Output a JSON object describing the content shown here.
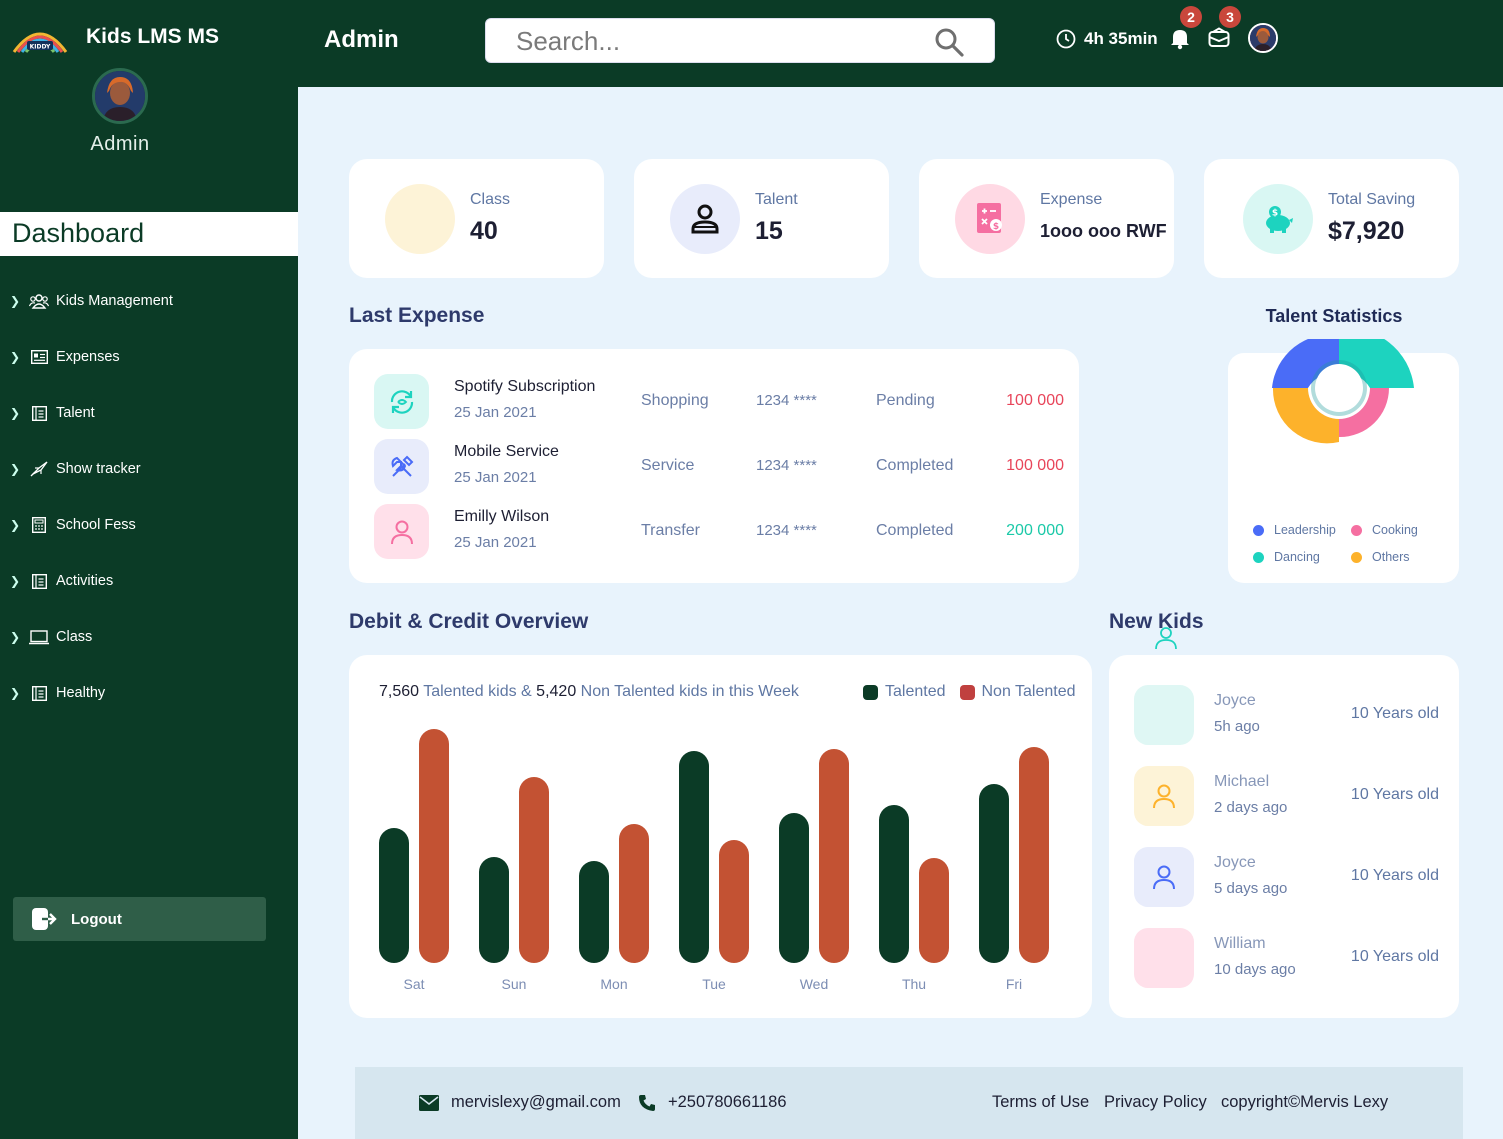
{
  "app": {
    "title": "Kids LMS MS",
    "logo_text": "KIDDY"
  },
  "sidebar": {
    "user_role": "Admin",
    "active": "Dashboard",
    "items": [
      {
        "label": "Kids Management",
        "icon": "users-icon"
      },
      {
        "label": "Expenses",
        "icon": "id-card-icon"
      },
      {
        "label": "Talent",
        "icon": "document-icon"
      },
      {
        "label": "Show tracker",
        "icon": "rocket-icon"
      },
      {
        "label": "School Fess",
        "icon": "calculator-icon"
      },
      {
        "label": "Activities",
        "icon": "document-icon"
      },
      {
        "label": "Class",
        "icon": "laptop-icon"
      },
      {
        "label": "Healthy",
        "icon": "document-icon"
      }
    ],
    "logout": "Logout"
  },
  "topbar": {
    "title": "Admin",
    "search_placeholder": "Search...",
    "timer": "4h 35min",
    "notifications_count": "2",
    "messages_count": "3"
  },
  "stats": [
    {
      "label": "Class",
      "value": "40",
      "color": "#fdf3d7"
    },
    {
      "label": "Talent",
      "value": "15",
      "color": "#e8ecfb"
    },
    {
      "label": "Expense",
      "value": "1ooo ooo RWF",
      "color": "#ffd9e4"
    },
    {
      "label": "Total Saving",
      "value": "$7,920",
      "color": "#d9f7f3"
    }
  ],
  "last_expense": {
    "title": "Last Expense",
    "rows": [
      {
        "name": "Spotify Subscription",
        "date": "25 Jan 2021",
        "category": "Shopping",
        "card": "1234 ****",
        "status": "Pending",
        "amount": "100 000",
        "amount_color": "#e8455a"
      },
      {
        "name": "Mobile Service",
        "date": "25 Jan 2021",
        "category": "Service",
        "card": "1234 ****",
        "status": "Completed",
        "amount": "100 000",
        "amount_color": "#e8455a"
      },
      {
        "name": "Emilly Wilson",
        "date": "25 Jan 2021",
        "category": "Transfer",
        "card": "1234 ****",
        "status": "Completed",
        "amount": "200 000",
        "amount_color": "#1bc9a8"
      }
    ]
  },
  "talent_statistics": {
    "title": "Talent Statistics",
    "legend": [
      {
        "label": "Leadership",
        "color": "#4a6cf7"
      },
      {
        "label": "Cooking",
        "color": "#f56fa1"
      },
      {
        "label": "Dancing",
        "color": "#1dd3bf"
      },
      {
        "label": "Others",
        "color": "#fdb22b"
      }
    ]
  },
  "overview": {
    "title": "Debit & Credit Overview",
    "talented_count": "7,560",
    "talented_text": "Talented kids &",
    "non_talented_count": "5,420",
    "non_talented_text": "Non Talented kids in this Week",
    "legend_talented": "Talented",
    "legend_non_talented": "Non Talented",
    "color_talented": "#0b3b26",
    "color_non_talented": "#c35233"
  },
  "chart_data": {
    "type": "bar",
    "categories": [
      "Sat",
      "Sun",
      "Mon",
      "Tue",
      "Wed",
      "Thu",
      "Fri"
    ],
    "series": [
      {
        "name": "Talented",
        "values": [
          135,
          106,
          102,
          212,
          150,
          158,
          179
        ]
      },
      {
        "name": "Non Talented",
        "values": [
          234,
          186,
          139,
          123,
          214,
          105,
          216
        ]
      }
    ],
    "ylim": [
      0,
      240
    ]
  },
  "new_kids": {
    "title": "New Kids",
    "items": [
      {
        "name": "Joyce",
        "time": "5h ago",
        "age": "10 Years old",
        "color": "#dff7f4",
        "icon": ""
      },
      {
        "name": "Michael",
        "time": "2 days ago",
        "age": "10 Years old",
        "color": "#fdf3d7",
        "icon": "user-icon"
      },
      {
        "name": "Joyce",
        "time": "5 days ago",
        "age": "10 Years old",
        "color": "#e8ecfb",
        "icon": "user-icon"
      },
      {
        "name": "William",
        "time": "10 days ago",
        "age": "10 Years old",
        "color": "#ffe0ea",
        "icon": ""
      }
    ]
  },
  "footer": {
    "email": "mervislexy@gmail.com",
    "phone": "+250780661186",
    "terms": "Terms of Use",
    "privacy": "Privacy Policy",
    "copyright": "copyright©Mervis Lexy"
  }
}
